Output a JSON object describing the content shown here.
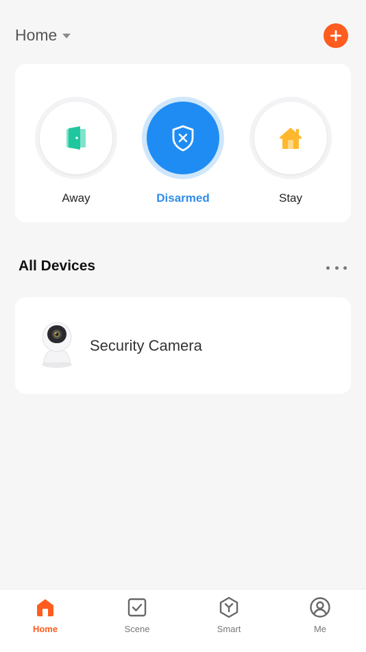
{
  "header": {
    "home_title": "Home",
    "add_icon": "plus-icon",
    "accent_color": "#ff5c1f"
  },
  "modes": [
    {
      "id": "away",
      "label": "Away",
      "icon": "door-icon",
      "active": false
    },
    {
      "id": "disarmed",
      "label": "Disarmed",
      "icon": "shield-x-icon",
      "active": true
    },
    {
      "id": "stay",
      "label": "Stay",
      "icon": "house-icon",
      "active": false
    }
  ],
  "devices_section": {
    "title": "All Devices",
    "more_icon": "more-dots-icon",
    "items": [
      {
        "name": "Security Camera",
        "icon": "security-camera-image"
      }
    ]
  },
  "tab_bar": {
    "tabs": [
      {
        "label": "Home",
        "icon": "home-icon",
        "active": true
      },
      {
        "label": "Scene",
        "icon": "scene-checkbox-icon",
        "active": false
      },
      {
        "label": "Smart",
        "icon": "smart-cube-icon",
        "active": false
      },
      {
        "label": "Me",
        "icon": "profile-icon",
        "active": false
      }
    ]
  },
  "colors": {
    "active_blue": "#1f8cf3",
    "active_label_blue": "#2f8ee8",
    "away_green": "#22c9a1",
    "stay_yellow": "#ffb82e"
  }
}
